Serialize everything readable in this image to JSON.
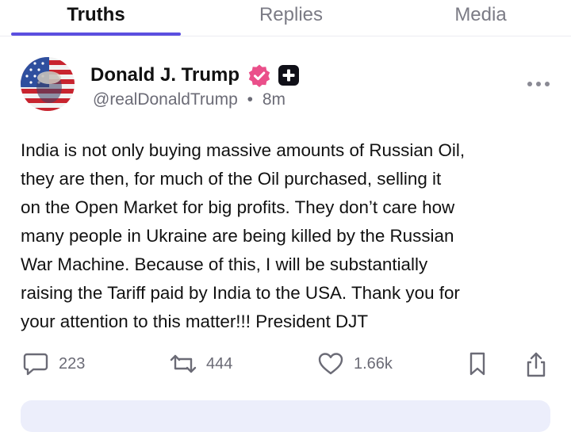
{
  "tabs": [
    {
      "label": "Truths",
      "active": true
    },
    {
      "label": "Replies",
      "active": false
    },
    {
      "label": "Media",
      "active": false
    }
  ],
  "post": {
    "author_name": "Donald J. Trump",
    "handle": "@realDonaldTrump",
    "separator": "•",
    "time": "8m",
    "text": "India is not only buying massive amounts of Russian Oil,\nthey are then, for much of the Oil purchased, selling it\non the Open Market for big profits. They don’t care how\nmany people in Ukraine are being killed by the Russian\nWar Machine. Because of this, I will be substantially\nraising the Tariff paid by India to the USA. Thank you for\nyour attention to this matter!!! President DJT"
  },
  "actions": {
    "replies": "223",
    "retruths": "444",
    "likes": "1.66k"
  },
  "icons": [
    "verified-badge-icon",
    "plus-badge-icon",
    "more-icon",
    "reply-icon",
    "retruth-icon",
    "like-icon",
    "bookmark-icon",
    "share-icon"
  ],
  "colors": {
    "accent": "#5b4fe0",
    "verified": "#ea4f8a",
    "muted": "#6b6b76"
  }
}
